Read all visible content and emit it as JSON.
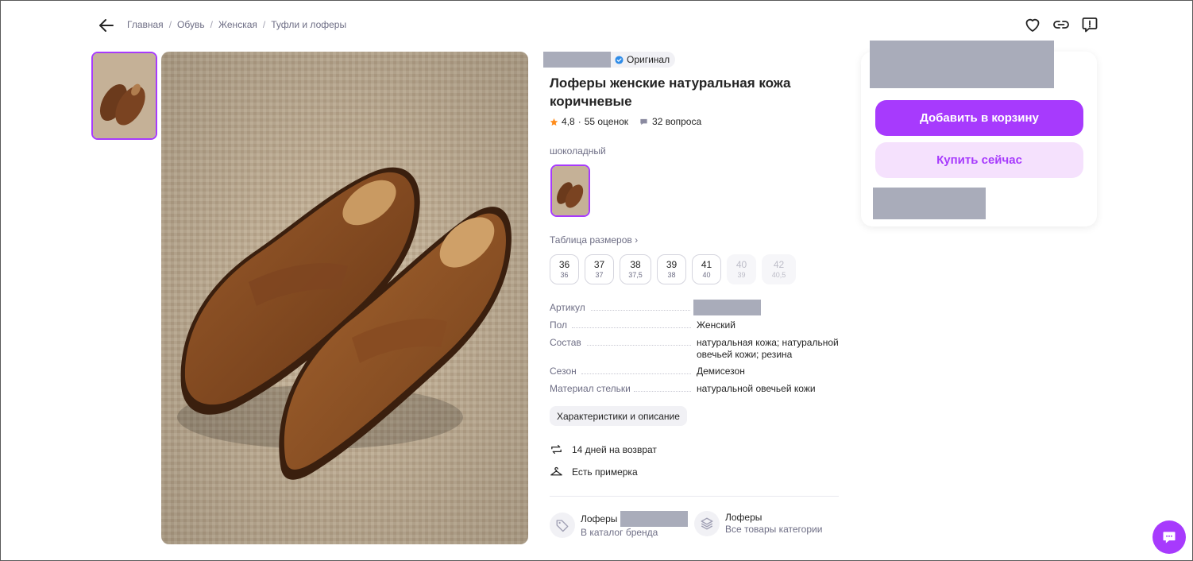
{
  "breadcrumb": [
    "Главная",
    "Обувь",
    "Женская",
    "Туфли и лоферы"
  ],
  "product": {
    "badge": "Оригинал",
    "title": "Лоферы женские натуральная кожа коричневые",
    "rating": "4,8",
    "rating_sep": "·",
    "reviews": "55 оценок",
    "questions": "32 вопроса",
    "color_name": "шоколадный"
  },
  "size_table_label": "Таблица размеров",
  "sizes": [
    {
      "ru": "36",
      "eu": "36",
      "available": true
    },
    {
      "ru": "37",
      "eu": "37",
      "available": true
    },
    {
      "ru": "38",
      "eu": "37,5",
      "available": true
    },
    {
      "ru": "39",
      "eu": "38",
      "available": true
    },
    {
      "ru": "41",
      "eu": "40",
      "available": true
    },
    {
      "ru": "40",
      "eu": "39",
      "available": false
    },
    {
      "ru": "42",
      "eu": "40,5",
      "available": false
    }
  ],
  "specs": {
    "article_label": "Артикул",
    "gender_label": "Пол",
    "gender_value": "Женский",
    "composition_label": "Состав",
    "composition_value": "натуральная кожа; натуральной овечьей кожи; резина",
    "season_label": "Сезон",
    "season_value": "Демисезон",
    "insole_label": "Материал стельки",
    "insole_value": "натуральной овечьей кожи"
  },
  "chars_button": "Характеристики и описание",
  "features": {
    "return": "14 дней на возврат",
    "fitting": "Есть примерка"
  },
  "links": {
    "brand_title": "Лоферы",
    "brand_sub": "В каталог бренда",
    "category_title": "Лоферы",
    "category_sub": "Все товары категории"
  },
  "buy": {
    "add_to_cart": "Добавить в корзину",
    "buy_now": "Купить сейчас"
  },
  "colors": {
    "accent": "#a73afd",
    "accent_light": "#f5e1fd",
    "muted_text": "#6e6e85",
    "redaction": "#a9acba",
    "star": "#ff8c1a",
    "verified": "#2f8ce8"
  }
}
